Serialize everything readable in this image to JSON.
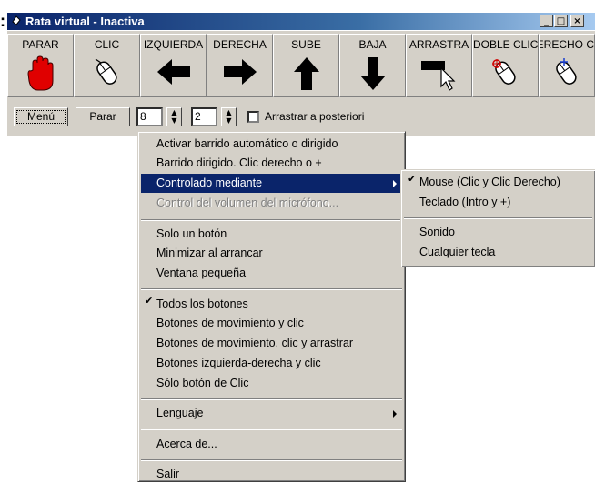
{
  "window": {
    "title": "Rata virtual - Inactiva",
    "prefix_glyph": ":",
    "controls": [
      "_",
      "□",
      "×"
    ]
  },
  "toolbar": {
    "buttons": [
      {
        "label": "PARAR",
        "icon": "red-hand-icon"
      },
      {
        "label": "CLIC",
        "icon": "mouse-click-icon"
      },
      {
        "label": "IZQUIERDA",
        "icon": "arrow-left-icon"
      },
      {
        "label": "DERECHA",
        "icon": "arrow-right-icon"
      },
      {
        "label": "SUBE",
        "icon": "arrow-up-icon"
      },
      {
        "label": "BAJA",
        "icon": "arrow-down-icon"
      },
      {
        "label": "ARRASTRA",
        "icon": "drag-cursor-icon"
      },
      {
        "label": "DOBLE CLIC",
        "icon": "mouse-double-click-icon"
      },
      {
        "label": "DERECHO CLIC",
        "icon": "mouse-right-click-icon"
      }
    ]
  },
  "controls": {
    "menu_label": "Menú",
    "stop_label": "Parar",
    "spinner1_value": "8",
    "spinner2_value": "2",
    "drag_checkbox_label": "Arrastrar a posteriori",
    "spin_up": "▲",
    "spin_down": "▼"
  },
  "main_menu": {
    "items": [
      {
        "label": "Activar barrido automático o dirigido"
      },
      {
        "label": "Barrido dirigido. Clic derecho o +"
      },
      {
        "label": "Controlado mediante",
        "submenu": true,
        "selected": true
      },
      {
        "label": "Control del volumen del micrófono...",
        "disabled": true
      },
      {
        "label": "Solo un botón"
      },
      {
        "label": "Minimizar al arrancar"
      },
      {
        "label": "Ventana pequeña"
      },
      {
        "label": "Todos los botones",
        "checked": true
      },
      {
        "label": "Botones de movimiento y clic"
      },
      {
        "label": "Botones de movimiento, clic y arrastrar"
      },
      {
        "label": "Botones izquierda-derecha y clic"
      },
      {
        "label": "Sólo botón de Clic"
      },
      {
        "label": "Lenguaje",
        "submenu": true
      },
      {
        "label": "Acerca de..."
      },
      {
        "label": "Salir"
      }
    ]
  },
  "sub_menu": {
    "items": [
      {
        "label": "Mouse (Clic y Clic Derecho)",
        "checked": true
      },
      {
        "label": "Teclado (Intro y +)"
      },
      {
        "label": "Sonido"
      },
      {
        "label": "Cualquier tecla"
      }
    ]
  },
  "check_glyph": "✔",
  "colors": {
    "titlebar_start": "#0a246a",
    "titlebar_end": "#a6caf0",
    "highlight": "#0a246a",
    "face": "#d4d0c8"
  }
}
